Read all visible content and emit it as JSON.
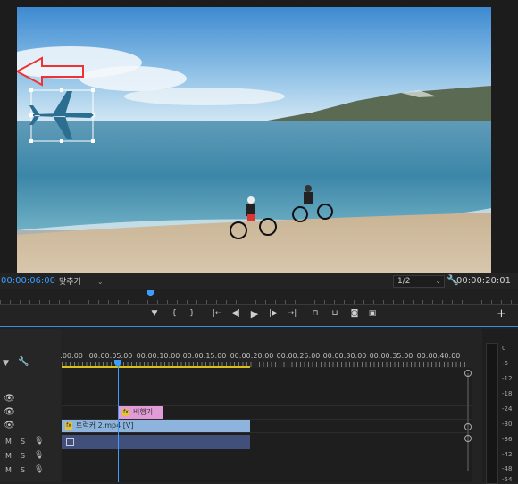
{
  "program_monitor": {
    "current_timecode": "00:00:06:00",
    "duration_timecode": "00:00:20:01",
    "fit_label": "맞추기",
    "resolution_label": "1/2"
  },
  "transport": {
    "buttons": [
      "marker-icon",
      "in-point-icon",
      "out-point-icon",
      "go-to-in-icon",
      "step-back-icon",
      "play-icon",
      "step-forward-icon",
      "go-to-out-icon",
      "insert-icon",
      "overwrite-icon",
      "export-frame-icon",
      "comparison-view-icon"
    ]
  },
  "timeline": {
    "ruler_labels": [
      ":00:00",
      "00:00:05:00",
      "00:00:10:00",
      "00:00:15:00",
      "00:00:20:00",
      "00:00:25:00",
      "00:00:30:00",
      "00:00:35:00",
      "00:00:40:00"
    ],
    "graphic_clip_label": "비행기",
    "video_clip_label": "트럭커 2.mp4 [V]",
    "track_labels": {
      "mute": "M",
      "solo": "S"
    }
  },
  "audio_meter": {
    "db_labels": [
      "0",
      "-6",
      "-12",
      "-18",
      "-24",
      "-30",
      "-36",
      "-42",
      "-48",
      "-54"
    ]
  },
  "colors": {
    "accent": "#3a9dff",
    "graphic_clip": "#e39bd8",
    "video_clip": "#8eb4de",
    "audio_clip": "#40507a",
    "work_area": "#d8c21a"
  }
}
